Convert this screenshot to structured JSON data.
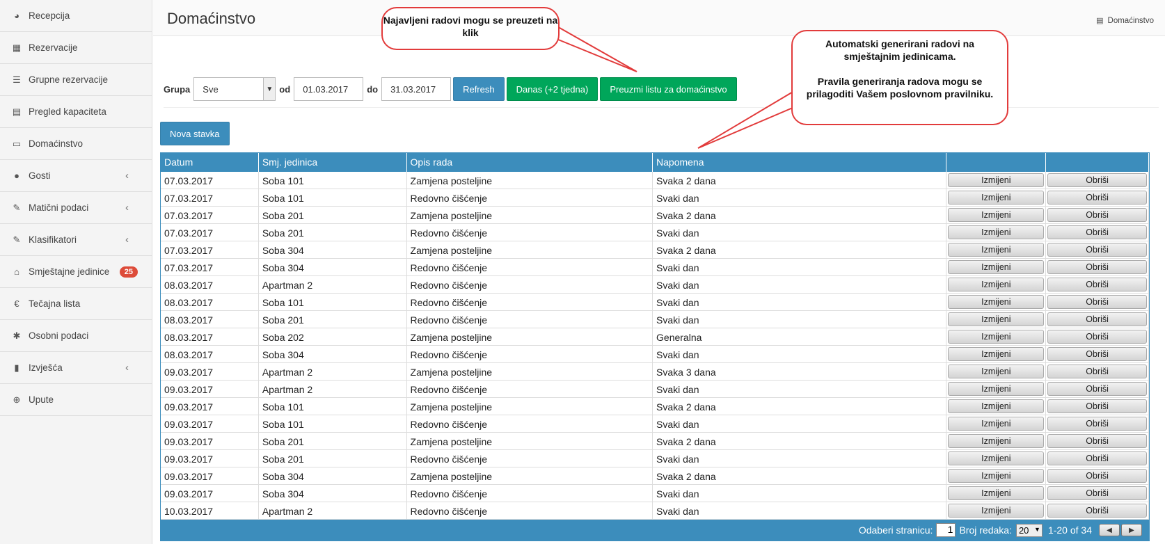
{
  "sidebar": {
    "items": [
      {
        "label": "Recepcija",
        "icon": "dashboard-icon",
        "glyph": "◕"
      },
      {
        "label": "Rezervacije",
        "icon": "grid-icon",
        "glyph": "▦"
      },
      {
        "label": "Grupne rezervacije",
        "icon": "list-icon",
        "glyph": "☰"
      },
      {
        "label": "Pregled kapaciteta",
        "icon": "calendar-icon",
        "glyph": "▤"
      },
      {
        "label": "Domaćinstvo",
        "icon": "table-icon",
        "glyph": "▭"
      },
      {
        "label": "Gosti",
        "icon": "users-icon",
        "glyph": "●",
        "chevron": true
      },
      {
        "label": "Matični podaci",
        "icon": "edit-icon",
        "glyph": "✎",
        "chevron": true
      },
      {
        "label": "Klasifikatori",
        "icon": "edit-icon",
        "glyph": "✎",
        "chevron": true
      },
      {
        "label": "Smještajne jedinice",
        "icon": "home-icon",
        "glyph": "⌂",
        "badge": "25"
      },
      {
        "label": "Tečajna lista",
        "icon": "euro-icon",
        "glyph": "€"
      },
      {
        "label": "Osobni podaci",
        "icon": "asterisk-icon",
        "glyph": "✱"
      },
      {
        "label": "Izvješća",
        "icon": "bar-chart-icon",
        "glyph": "▮",
        "chevron": true
      },
      {
        "label": "Upute",
        "icon": "download-circle-icon",
        "glyph": "⊕"
      }
    ]
  },
  "header": {
    "title": "Domaćinstvo",
    "breadcrumb": "Domaćinstvo"
  },
  "toolbar": {
    "grupa_label": "Grupa",
    "grupa_value": "Sve",
    "od_label": "od",
    "od_value": "01.03.2017",
    "do_label": "do",
    "do_value": "31.03.2017",
    "refresh_label": "Refresh",
    "danas_label": "Danas (+2 tjedna)",
    "preuzmi_label": "Preuzmi listu za domaćinstvo",
    "nova_label": "Nova stavka"
  },
  "table": {
    "headers": [
      "Datum",
      "Smj. jedinica",
      "Opis rada",
      "Napomena",
      "",
      ""
    ],
    "edit_label": "Izmijeni",
    "delete_label": "Obriši",
    "rows": [
      [
        "07.03.2017",
        "Soba 101",
        "Zamjena posteljine",
        "Svaka 2 dana"
      ],
      [
        "07.03.2017",
        "Soba 101",
        "Redovno čišćenje",
        "Svaki dan"
      ],
      [
        "07.03.2017",
        "Soba 201",
        "Zamjena posteljine",
        "Svaka 2 dana"
      ],
      [
        "07.03.2017",
        "Soba 201",
        "Redovno čišćenje",
        "Svaki dan"
      ],
      [
        "07.03.2017",
        "Soba 304",
        "Zamjena posteljine",
        "Svaka 2 dana"
      ],
      [
        "07.03.2017",
        "Soba 304",
        "Redovno čišćenje",
        "Svaki dan"
      ],
      [
        "08.03.2017",
        "Apartman 2",
        "Redovno čišćenje",
        "Svaki dan"
      ],
      [
        "08.03.2017",
        "Soba 101",
        "Redovno čišćenje",
        "Svaki dan"
      ],
      [
        "08.03.2017",
        "Soba 201",
        "Redovno čišćenje",
        "Svaki dan"
      ],
      [
        "08.03.2017",
        "Soba 202",
        "Zamjena posteljine",
        "Generalna"
      ],
      [
        "08.03.2017",
        "Soba 304",
        "Redovno čišćenje",
        "Svaki dan"
      ],
      [
        "09.03.2017",
        "Apartman 2",
        "Zamjena posteljine",
        "Svaka 3 dana"
      ],
      [
        "09.03.2017",
        "Apartman 2",
        "Redovno čišćenje",
        "Svaki dan"
      ],
      [
        "09.03.2017",
        "Soba 101",
        "Zamjena posteljine",
        "Svaka 2 dana"
      ],
      [
        "09.03.2017",
        "Soba 101",
        "Redovno čišćenje",
        "Svaki dan"
      ],
      [
        "09.03.2017",
        "Soba 201",
        "Zamjena posteljine",
        "Svaka 2 dana"
      ],
      [
        "09.03.2017",
        "Soba 201",
        "Redovno čišćenje",
        "Svaki dan"
      ],
      [
        "09.03.2017",
        "Soba 304",
        "Zamjena posteljine",
        "Svaka 2 dana"
      ],
      [
        "09.03.2017",
        "Soba 304",
        "Redovno čišćenje",
        "Svaki dan"
      ],
      [
        "10.03.2017",
        "Apartman 2",
        "Redovno čišćenje",
        "Svaki dan"
      ]
    ]
  },
  "pager": {
    "page_label": "Odaberi stranicu:",
    "page_value": "1",
    "rows_label": "Broj redaka:",
    "rows_value": "20",
    "range": "1-20 of 34"
  },
  "callouts": {
    "top": "Najavljeni radovi mogu se preuzeti na klik",
    "right_line1": "Automatski generirani radovi na smještajnim jedinicama.",
    "right_line2": "Pravila generiranja radova mogu se prilagoditi Vašem poslovnom pravilniku."
  },
  "colors": {
    "primary": "#3c8dbc",
    "success": "#00a65a",
    "callout_border": "#e23b3b",
    "badge": "#dd4b39"
  }
}
